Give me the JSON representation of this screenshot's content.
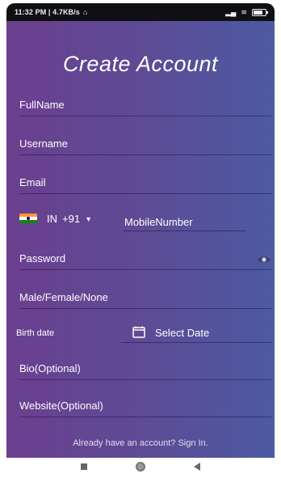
{
  "status_bar": {
    "time_speed": "11:32 PM | 4.7KB/s"
  },
  "screen": {
    "title": "Create Account",
    "fields": {
      "fullname": "FullName",
      "username": "Username",
      "email": "Email",
      "password": "Password",
      "gender": "Male/Female/None",
      "bio": "Bio(Optional)",
      "website": "Website(Optional)"
    },
    "phone": {
      "country_code_iso": "IN",
      "dial_code": "+91",
      "mobile_placeholder": "MobileNumber"
    },
    "birth": {
      "label": "Birth date",
      "select_text": "Select Date"
    },
    "signin_text": "Already have an account? Sign In."
  },
  "colors": {
    "gradient_left": "#6b3f8f",
    "gradient_right": "#4c5aa2",
    "text": "#ffffff"
  },
  "icons": [
    "wifi-icon",
    "battery-icon",
    "india-flag-icon",
    "chevron-down-icon",
    "eye-icon",
    "calendar-icon",
    "recents-icon",
    "home-icon",
    "back-icon"
  ]
}
